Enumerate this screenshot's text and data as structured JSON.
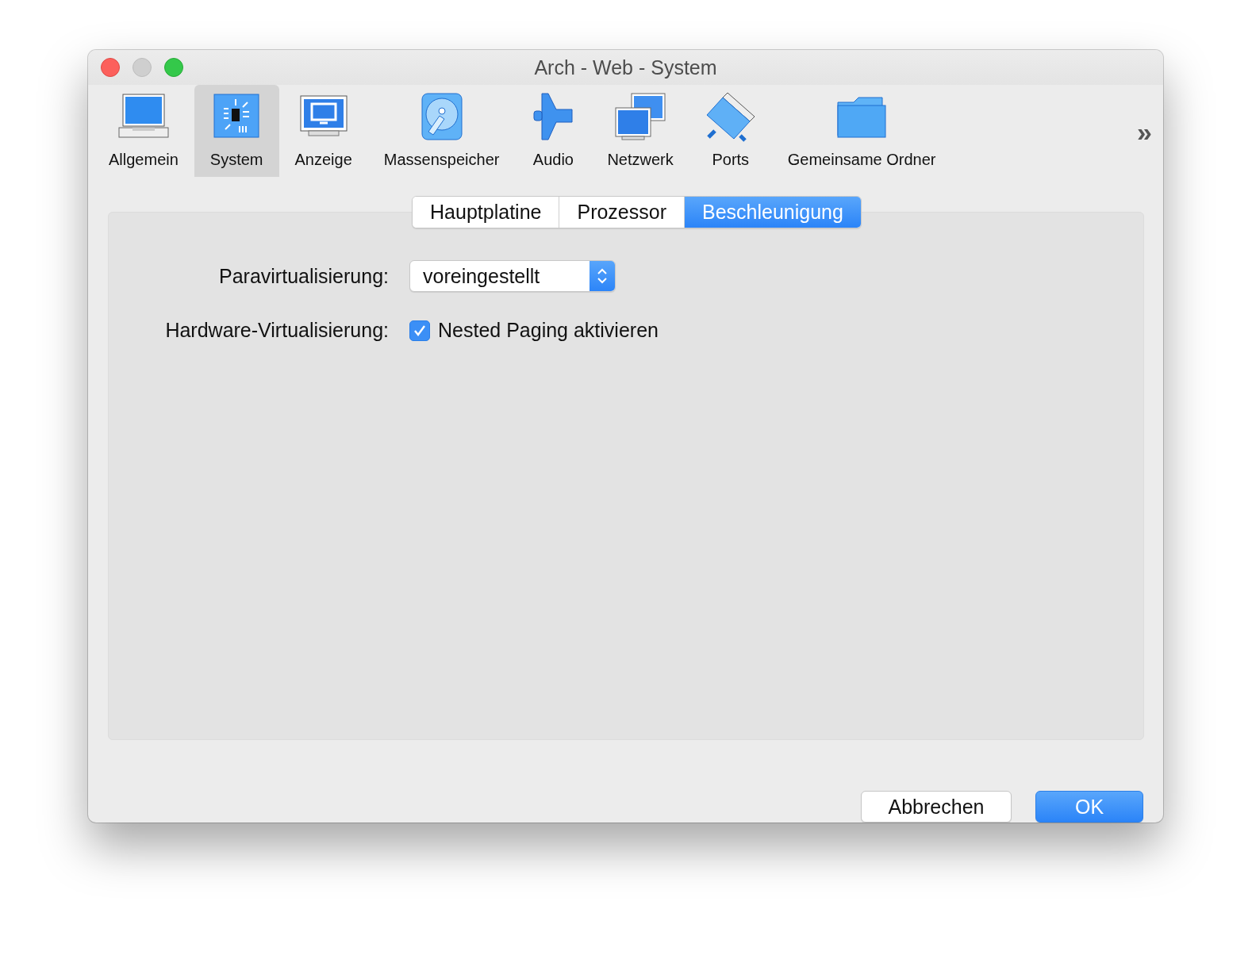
{
  "window": {
    "title": "Arch - Web - System"
  },
  "toolbar": {
    "items": [
      {
        "label": "Allgemein",
        "kind": "laptop",
        "selected": false
      },
      {
        "label": "System",
        "kind": "chip",
        "selected": true
      },
      {
        "label": "Anzeige",
        "kind": "display",
        "selected": false
      },
      {
        "label": "Massenspeicher",
        "kind": "disk",
        "selected": false
      },
      {
        "label": "Audio",
        "kind": "speaker",
        "selected": false
      },
      {
        "label": "Netzwerk",
        "kind": "network",
        "selected": false
      },
      {
        "label": "Ports",
        "kind": "port",
        "selected": false
      },
      {
        "label": "Gemeinsame Ordner",
        "kind": "folder",
        "selected": false
      }
    ],
    "overflow": "»"
  },
  "tabs": [
    {
      "label": "Hauptplatine",
      "selected": false
    },
    {
      "label": "Prozessor",
      "selected": false
    },
    {
      "label": "Beschleunigung",
      "selected": true
    }
  ],
  "form": [
    {
      "kind": "select",
      "label": "Paravirtualisierung:",
      "value": "voreingestellt"
    },
    {
      "kind": "checkbox",
      "label": "Hardware-Virtualisierung:",
      "text": "Nested Paging aktivieren",
      "checked": true
    }
  ],
  "buttons": [
    {
      "label": "Abbrechen",
      "default": false
    },
    {
      "label": "OK",
      "default": true
    }
  ]
}
